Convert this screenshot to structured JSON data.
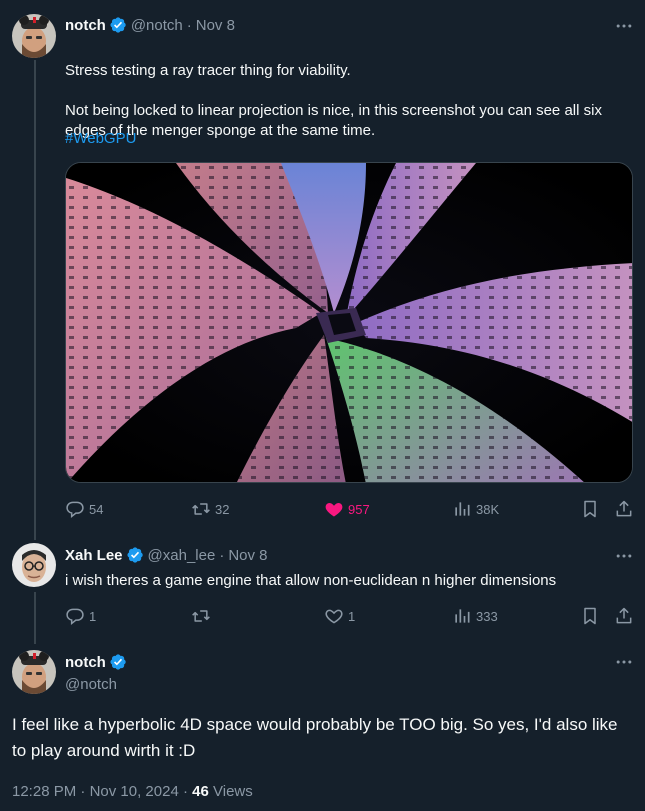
{
  "colors": {
    "background": "#15202b",
    "text": "#f7f9f9",
    "muted": "#8b98a5",
    "accent": "#1d9bf0",
    "like": "#f91880",
    "divider": "#38444d"
  },
  "tweet1": {
    "name": "notch",
    "handle": "@notch",
    "sep": "·",
    "date": "Nov 8",
    "line1": "Stress testing a ray tracer thing for viability.",
    "line2": "Not being locked to linear projection is nice, in this screenshot you can see all six edges of the menger sponge at the same time.",
    "hashtag": "#WebGPU",
    "image_subject": "menger sponge render",
    "replies": "54",
    "retweets": "32",
    "likes": "957",
    "views": "38K",
    "liked": true
  },
  "tweet2": {
    "name": "Xah Lee",
    "handle": "@xah_lee",
    "sep": "·",
    "date": "Nov 8",
    "text": "i wish theres a game engine that allow non-euclidean n higher dimensions",
    "replies": "1",
    "retweets": "",
    "likes": "1",
    "views": "333"
  },
  "main_tweet": {
    "name": "notch",
    "handle": "@notch",
    "text": "I feel like a hyperbolic 4D space would probably be TOO big. So yes, I'd also like to play around wirth it :D",
    "time": "12:28 PM",
    "sep": "·",
    "date": "Nov 10, 2024",
    "sep2": "·",
    "views_count": "46",
    "views_label": "Views"
  },
  "icons": {
    "verified": "verified-badge-icon",
    "more": "more-dots-icon",
    "reply": "reply-icon",
    "retweet": "retweet-icon",
    "like": "heart-icon",
    "views": "views-chart-icon",
    "bookmark": "bookmark-icon",
    "share": "share-icon"
  }
}
